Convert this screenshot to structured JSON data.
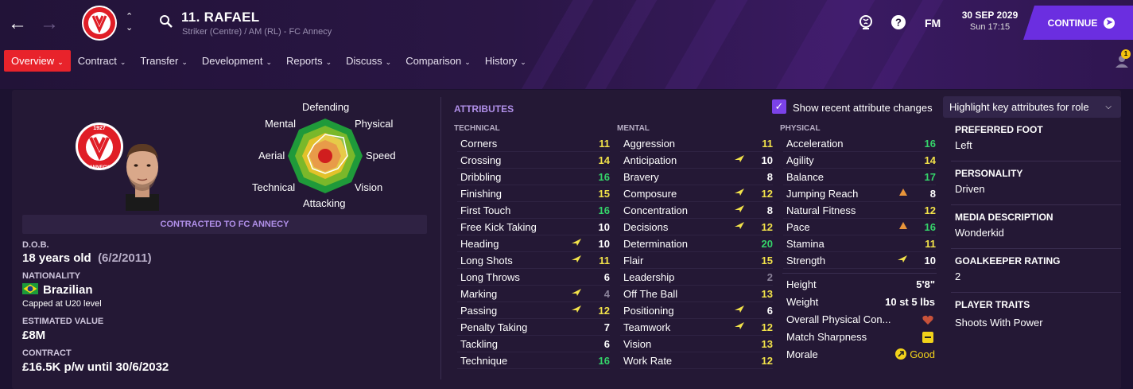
{
  "header": {
    "player_title": "11. RAFAEL",
    "player_subtitle": "Striker (Centre) / AM (RL) - FC Annecy",
    "fm_label": "FM",
    "date": "30 SEP 2029",
    "day_time": "Sun 17:15",
    "continue_label": "CONTINUE",
    "notification_count": "1"
  },
  "crest": {
    "year": "1927",
    "name": "ANNECY"
  },
  "tabs": [
    {
      "label": "Overview"
    },
    {
      "label": "Contract"
    },
    {
      "label": "Transfer"
    },
    {
      "label": "Development"
    },
    {
      "label": "Reports"
    },
    {
      "label": "Discuss"
    },
    {
      "label": "Comparison"
    },
    {
      "label": "History"
    }
  ],
  "polar": {
    "labels": {
      "top": "Defending",
      "top_left": "Mental",
      "top_right": "Physical",
      "left": "Aerial",
      "right": "Speed",
      "bottom_left": "Technical",
      "bottom_right": "Vision",
      "bottom": "Attacking"
    }
  },
  "profile": {
    "contracted_label": "CONTRACTED TO FC ANNECY",
    "dob_label": "D.O.B.",
    "age": "18 years old",
    "dob": "(6/2/2011)",
    "nationality_label": "NATIONALITY",
    "nationality": "Brazilian",
    "caps": "Capped at U20 level",
    "value_label": "ESTIMATED VALUE",
    "value": "£8M",
    "contract_label": "CONTRACT",
    "contract": "£16.5K p/w until 30/6/2032"
  },
  "attributes": {
    "title": "ATTRIBUTES",
    "show_changes_label": "Show recent attribute changes",
    "highlight_label": "Highlight key attributes for role",
    "technical_label": "TECHNICAL",
    "mental_label": "MENTAL",
    "physical_label": "PHYSICAL",
    "technical": [
      {
        "name": "Corners",
        "value": "11",
        "trend": ""
      },
      {
        "name": "Crossing",
        "value": "14",
        "trend": ""
      },
      {
        "name": "Dribbling",
        "value": "16",
        "trend": ""
      },
      {
        "name": "Finishing",
        "value": "15",
        "trend": ""
      },
      {
        "name": "First Touch",
        "value": "16",
        "trend": ""
      },
      {
        "name": "Free Kick Taking",
        "value": "10",
        "trend": ""
      },
      {
        "name": "Heading",
        "value": "10",
        "trend": "up"
      },
      {
        "name": "Long Shots",
        "value": "11",
        "trend": "up"
      },
      {
        "name": "Long Throws",
        "value": "6",
        "trend": ""
      },
      {
        "name": "Marking",
        "value": "4",
        "trend": "up"
      },
      {
        "name": "Passing",
        "value": "12",
        "trend": "up"
      },
      {
        "name": "Penalty Taking",
        "value": "7",
        "trend": ""
      },
      {
        "name": "Tackling",
        "value": "6",
        "trend": ""
      },
      {
        "name": "Technique",
        "value": "16",
        "trend": ""
      }
    ],
    "mental": [
      {
        "name": "Aggression",
        "value": "11",
        "trend": ""
      },
      {
        "name": "Anticipation",
        "value": "10",
        "trend": "up"
      },
      {
        "name": "Bravery",
        "value": "8",
        "trend": ""
      },
      {
        "name": "Composure",
        "value": "12",
        "trend": "up"
      },
      {
        "name": "Concentration",
        "value": "8",
        "trend": "up"
      },
      {
        "name": "Decisions",
        "value": "12",
        "trend": "up"
      },
      {
        "name": "Determination",
        "value": "20",
        "trend": ""
      },
      {
        "name": "Flair",
        "value": "15",
        "trend": ""
      },
      {
        "name": "Leadership",
        "value": "2",
        "trend": ""
      },
      {
        "name": "Off The Ball",
        "value": "13",
        "trend": ""
      },
      {
        "name": "Positioning",
        "value": "6",
        "trend": "up"
      },
      {
        "name": "Teamwork",
        "value": "12",
        "trend": "up"
      },
      {
        "name": "Vision",
        "value": "13",
        "trend": ""
      },
      {
        "name": "Work Rate",
        "value": "12",
        "trend": ""
      }
    ],
    "physical": [
      {
        "name": "Acceleration",
        "value": "16",
        "trend": ""
      },
      {
        "name": "Agility",
        "value": "14",
        "trend": ""
      },
      {
        "name": "Balance",
        "value": "17",
        "trend": ""
      },
      {
        "name": "Jumping Reach",
        "value": "8",
        "trend": "up-orange"
      },
      {
        "name": "Natural Fitness",
        "value": "12",
        "trend": ""
      },
      {
        "name": "Pace",
        "value": "16",
        "trend": "up-orange"
      },
      {
        "name": "Stamina",
        "value": "11",
        "trend": ""
      },
      {
        "name": "Strength",
        "value": "10",
        "trend": "up"
      }
    ],
    "physical_stats": [
      {
        "name": "Height",
        "value": "5'8\""
      },
      {
        "name": "Weight",
        "value": "10 st 5 lbs"
      },
      {
        "name": "Overall Physical Con...",
        "value": ""
      },
      {
        "name": "Match Sharpness",
        "value": ""
      },
      {
        "name": "Morale",
        "value": "Good"
      }
    ]
  },
  "right_panel": {
    "foot_label": "PREFERRED FOOT",
    "foot": "Left",
    "personality_label": "PERSONALITY",
    "personality": "Driven",
    "media_label": "MEDIA DESCRIPTION",
    "media": "Wonderkid",
    "gk_label": "GOALKEEPER RATING",
    "gk": "2",
    "traits_label": "PLAYER TRAITS",
    "traits": "Shoots With Power"
  },
  "colors": {
    "accent": "#6b2ee0",
    "active_tab": "#e8232b",
    "high_attr": "#35d46a",
    "mid_attr": "#f2e24a"
  }
}
